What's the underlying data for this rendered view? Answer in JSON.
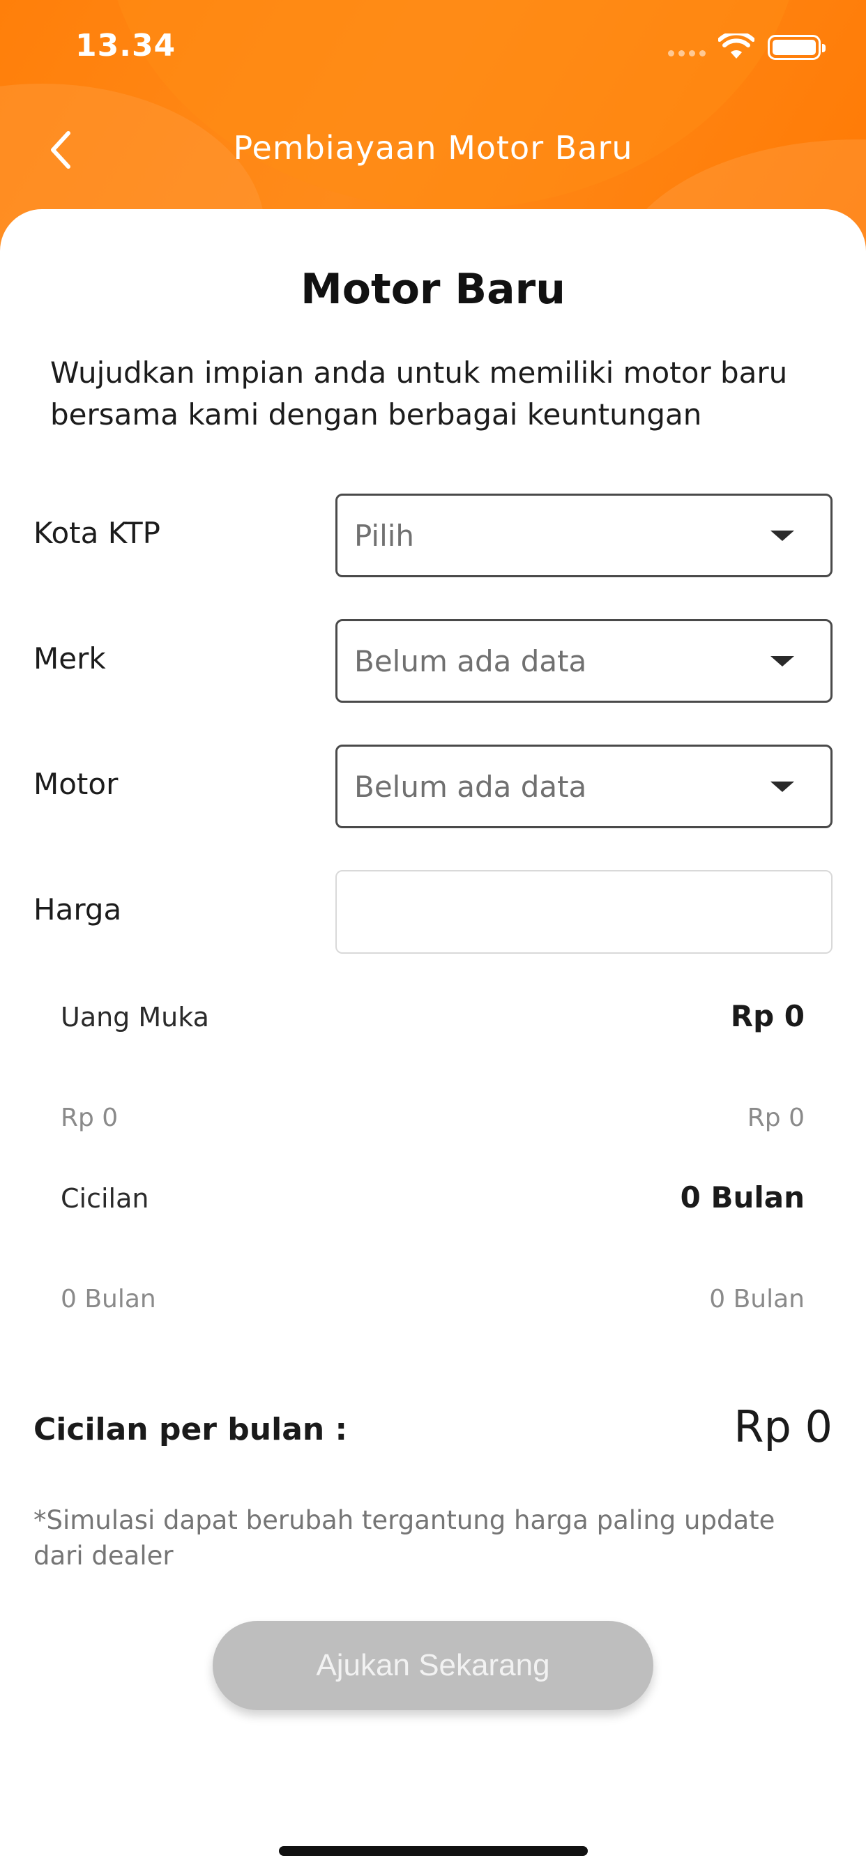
{
  "status_bar": {
    "time": "13.34"
  },
  "nav": {
    "title": "Pembiayaan Motor Baru",
    "back_icon": "chevron-left-icon"
  },
  "page": {
    "title": "Motor Baru",
    "intro": "Wujudkan impian anda untuk memiliki motor baru bersama kami dengan berbagai keuntungan"
  },
  "form": {
    "kota_ktp": {
      "label": "Kota KTP",
      "placeholder": "Pilih"
    },
    "merk": {
      "label": "Merk",
      "placeholder": "Belum ada data"
    },
    "motor": {
      "label": "Motor",
      "placeholder": "Belum ada data"
    },
    "harga": {
      "label": "Harga",
      "value": ""
    }
  },
  "uang_muka": {
    "label": "Uang Muka",
    "value": "Rp 0",
    "min": "Rp 0",
    "max": "Rp 0"
  },
  "cicilan": {
    "label": "Cicilan",
    "value": "0 Bulan",
    "min": "0 Bulan",
    "max": "0 Bulan"
  },
  "monthly": {
    "label": "Cicilan per bulan :",
    "value": "Rp 0"
  },
  "disclaimer": "*Simulasi dapat berubah tergantung harga paling update dari dealer",
  "submit": {
    "label": "Ajukan Sekarang"
  },
  "colors": {
    "accent": "#ff8000",
    "button_disabled": "#bebebe"
  }
}
